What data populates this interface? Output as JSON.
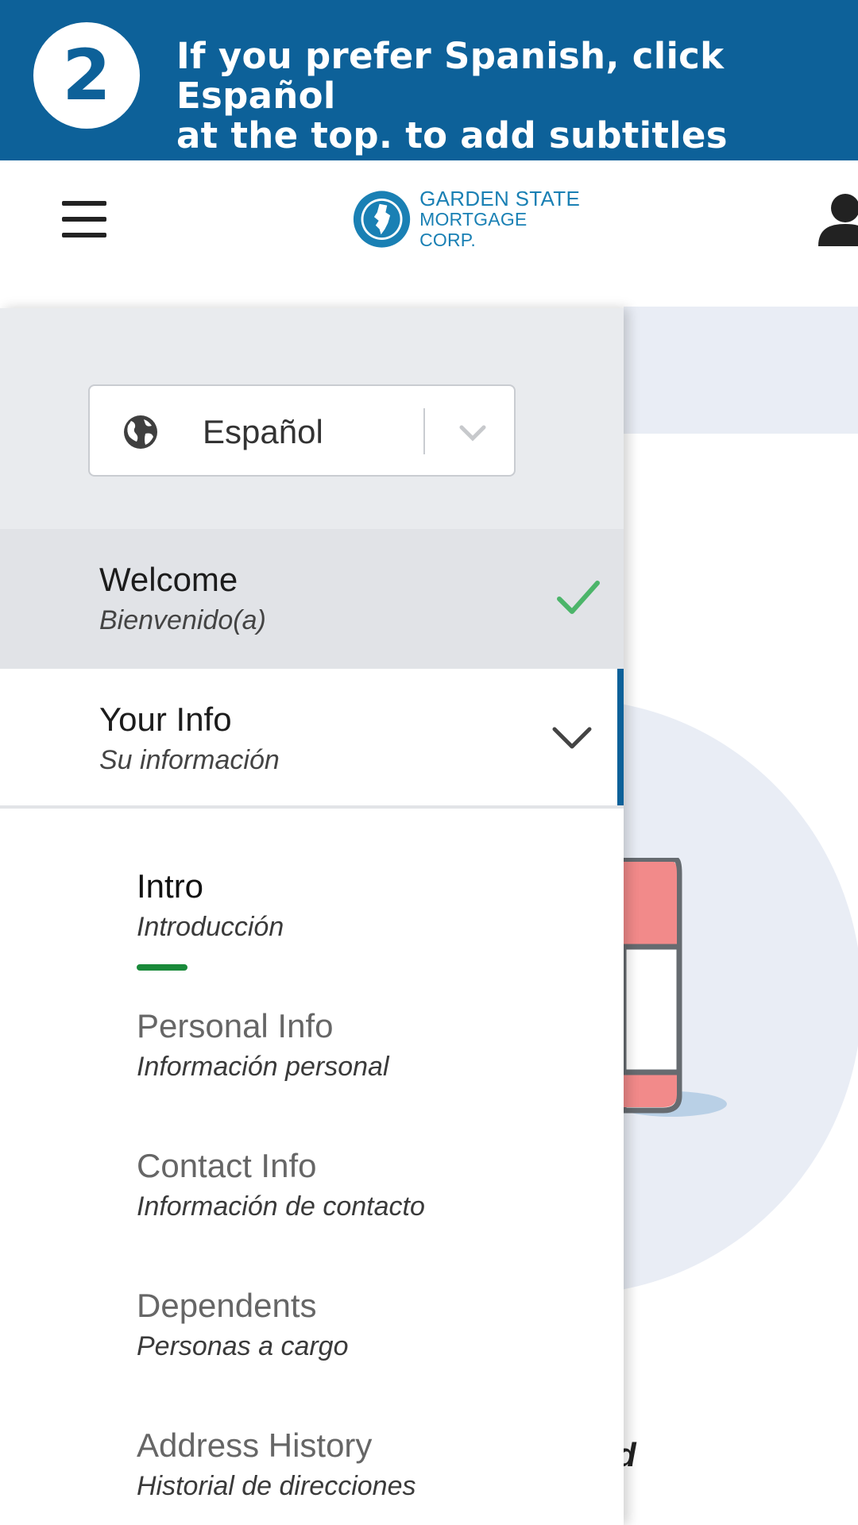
{
  "banner": {
    "step": "2",
    "line1": "If you prefer Spanish, click Español",
    "line2": "at the top. to add subtitles"
  },
  "header": {
    "logo_line1": "GARDEN STATE",
    "logo_line2": "MORTGAGE CORP.",
    "brand_color": "#1a80b4"
  },
  "language": {
    "value": "Español",
    "icon": "globe-icon"
  },
  "nav": {
    "welcome": {
      "title": "Welcome",
      "subtitle": "Bienvenido(a)",
      "status": "complete"
    },
    "your_info": {
      "title": "Your Info",
      "subtitle": "Su información",
      "expanded": true
    },
    "sub_items": [
      {
        "title": "Intro",
        "subtitle": "Introducción",
        "active": true
      },
      {
        "title": "Personal Info",
        "subtitle": "Información personal"
      },
      {
        "title": "Contact Info",
        "subtitle": "Información de contacto"
      },
      {
        "title": "Dependents",
        "subtitle": "Personas a cargo"
      },
      {
        "title": "Address History",
        "subtitle": "Historial de direcciones"
      }
    ]
  },
  "background": {
    "partial_text": "d"
  },
  "colors": {
    "banner": "#0d6199",
    "active_bar": "#0d6199",
    "check": "#4cb56a",
    "active_underline": "#1a8a3a"
  }
}
